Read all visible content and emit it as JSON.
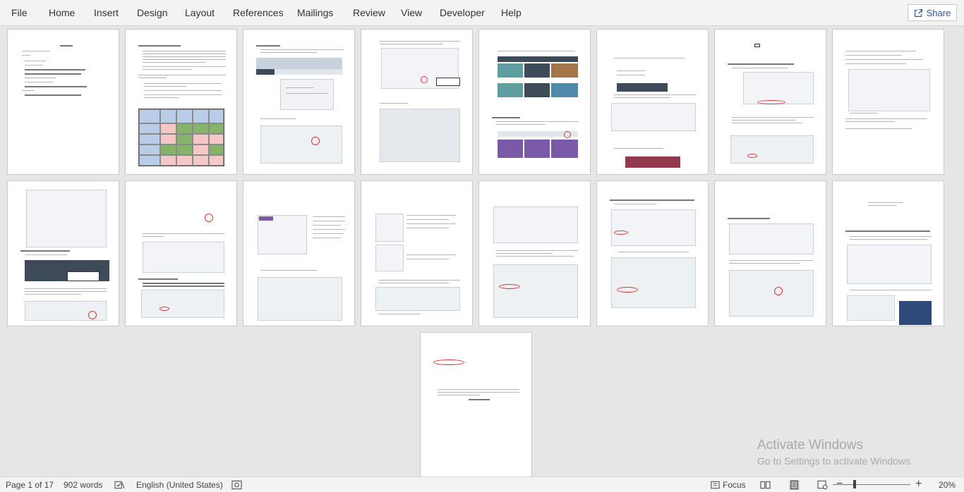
{
  "ribbon": {
    "tabs": [
      "File",
      "Home",
      "Insert",
      "Design",
      "Layout",
      "References",
      "Mailings",
      "Review",
      "View",
      "Developer",
      "Help"
    ],
    "share_label": "Share"
  },
  "document": {
    "page_count": 17
  },
  "status": {
    "page": "Page 1 of 17",
    "words": "902 words",
    "language": "English (United States)",
    "focus": "Focus",
    "zoom": "20%"
  },
  "watermark": {
    "title": "Activate Windows",
    "subtitle": "Go to Settings to activate Windows."
  },
  "colors": {
    "ribbon_bg": "#f3f3f3",
    "canvas_bg": "#e6e6e6",
    "accent": "#2b579a",
    "highlight_red": "#d33333"
  }
}
